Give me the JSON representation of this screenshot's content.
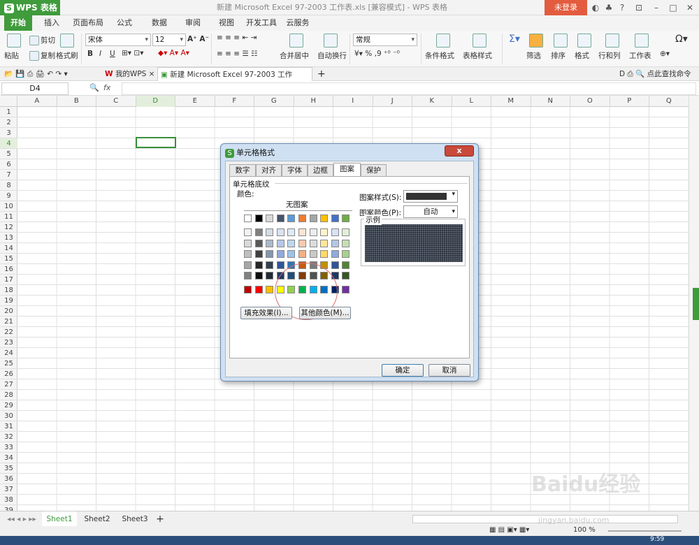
{
  "app": {
    "logo": "WPS 表格",
    "doc_title": "新建 Microsoft Excel 97-2003 工作表.xls [兼容模式] - WPS 表格",
    "login": "未登录"
  },
  "ribbon_tabs": [
    "开始",
    "插入",
    "页面布局",
    "公式",
    "数据",
    "审阅",
    "视图",
    "开发工具",
    "云服务"
  ],
  "ribbon": {
    "paste": "粘贴",
    "cut": "剪切",
    "copy": "复制",
    "format_painter": "格式刷",
    "font": "宋体",
    "size": "12",
    "bold": "B",
    "italic": "I",
    "underline": "U",
    "merge_center": "合并居中",
    "wrap": "自动换行",
    "number_format": "常规",
    "percent": "%",
    "comma": "9",
    "cond_format": "条件格式",
    "table_style": "表格样式",
    "filter": "筛选",
    "sort": "排序",
    "format": "格式",
    "rowcol": "行和列",
    "worksheet": "工作表",
    "find_hint": "点此查找命令"
  },
  "doc_tabs": {
    "mywps": "我的WPS",
    "file": "新建 Microsoft Excel 97-2003 工作表.xls"
  },
  "formula": {
    "name_box": "D4",
    "fx": "fx"
  },
  "columns": [
    "A",
    "B",
    "C",
    "D",
    "E",
    "F",
    "G",
    "H",
    "I",
    "J",
    "K",
    "L",
    "M",
    "N",
    "O",
    "P",
    "Q"
  ],
  "rows": [
    "1",
    "2",
    "3",
    "4",
    "5",
    "6",
    "7",
    "8",
    "9",
    "10",
    "11",
    "12",
    "13",
    "14",
    "15",
    "16",
    "17",
    "18",
    "19",
    "20",
    "21",
    "22",
    "23",
    "24",
    "25",
    "26",
    "27",
    "28",
    "29",
    "30",
    "31",
    "32",
    "33",
    "34",
    "35",
    "36",
    "37",
    "38",
    "39"
  ],
  "sheets": [
    "Sheet1",
    "Sheet2",
    "Sheet3"
  ],
  "status": {
    "zoom": "100 %",
    "time": "9:59"
  },
  "dialog": {
    "title": "单元格格式",
    "close": "x",
    "tabs": [
      "数字",
      "对齐",
      "字体",
      "边框",
      "图案",
      "保护"
    ],
    "section": "单元格底纹",
    "color_label": "颜色:",
    "no_pattern": "无图案",
    "fill_effect": "填充效果(I)...",
    "more_colors": "其他颜色(M)...",
    "pattern_style_label": "图案样式(S):",
    "pattern_color_label": "图案颜色(P):",
    "pattern_color_value": "自动",
    "sample_label": "示例",
    "ok": "确定",
    "cancel": "取消"
  },
  "palette": {
    "row0": [
      "#ffffff",
      "#000000",
      "#d9d9d9",
      "#44546a",
      "#5b9bd5",
      "#ed7d31",
      "#a5a5a5",
      "#ffc000",
      "#4472c4",
      "#70ad47"
    ],
    "grid": [
      [
        "#f2f2f2",
        "#7f7f7f",
        "#d6dce4",
        "#dae3f3",
        "#deebf7",
        "#fbe5d6",
        "#ededed",
        "#fff2cc",
        "#dae3f3",
        "#e2f0d9"
      ],
      [
        "#d9d9d9",
        "#595959",
        "#adb9ca",
        "#b4c7e7",
        "#bdd7ee",
        "#f8cbad",
        "#dbdbdb",
        "#ffe699",
        "#b4c7e7",
        "#c5e0b4"
      ],
      [
        "#bfbfbf",
        "#404040",
        "#8497b0",
        "#8faadc",
        "#9dc3e6",
        "#f4b183",
        "#c9c9c9",
        "#ffd966",
        "#8faadc",
        "#a9d18e"
      ],
      [
        "#a6a6a6",
        "#262626",
        "#333f50",
        "#2f5597",
        "#2e75b6",
        "#c55a11",
        "#7b7b7b",
        "#bf9000",
        "#2f5597",
        "#548235"
      ],
      [
        "#808080",
        "#0d0d0d",
        "#222a35",
        "#1f3864",
        "#1f4e79",
        "#843c0c",
        "#525252",
        "#7f6000",
        "#1f3864",
        "#375623"
      ]
    ],
    "standard": [
      "#c00000",
      "#ff0000",
      "#ffc000",
      "#ffff00",
      "#92d050",
      "#00b050",
      "#00b0f0",
      "#0070c0",
      "#002060",
      "#7030a0"
    ],
    "selected": "#b4c7e7"
  },
  "watermark": {
    "brand": "Baidu经验",
    "url": "jingyan.baidu.com"
  }
}
